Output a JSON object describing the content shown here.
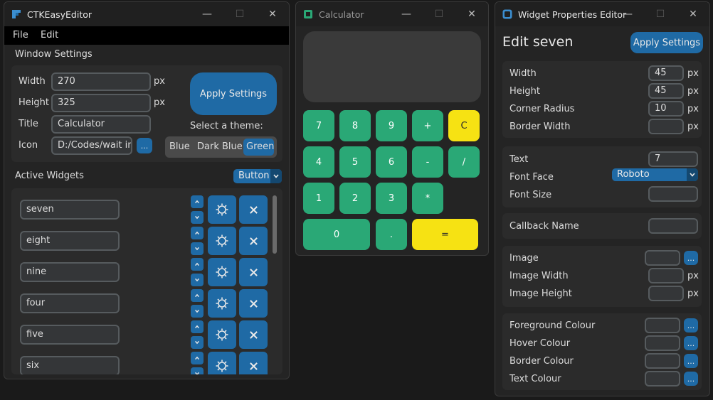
{
  "editor": {
    "title": "CTKEasyEditor",
    "menu": [
      "File",
      "Edit"
    ],
    "window_settings_label": "Window Settings",
    "width_label": "Width",
    "width_value": "270",
    "height_label": "Height",
    "height_value": "325",
    "title_label": "Title",
    "title_value": "Calculator",
    "icon_label": "Icon",
    "icon_value": "D:/Codes/wait im",
    "browse_label": "...",
    "px": "px",
    "apply_label": "Apply Settings",
    "theme_label": "Select a theme:",
    "themes": [
      "Blue",
      "Dark Blue",
      "Green"
    ],
    "active_theme": "Green",
    "active_widgets_label": "Active Widgets",
    "widget_type": "Button",
    "widgets": [
      "seven",
      "eight",
      "nine",
      "four",
      "five",
      "six"
    ],
    "colors": {
      "accent": "#1f6aa5",
      "panel": "#2b2b2b",
      "bg": "#242424"
    }
  },
  "calculator": {
    "title": "Calculator",
    "buttons": [
      {
        "label": "7",
        "color": "green"
      },
      {
        "label": "8",
        "color": "green"
      },
      {
        "label": "9",
        "color": "green"
      },
      {
        "label": "+",
        "color": "green"
      },
      {
        "label": "C",
        "color": "yellow"
      },
      {
        "label": "4",
        "color": "green"
      },
      {
        "label": "5",
        "color": "green"
      },
      {
        "label": "6",
        "color": "green"
      },
      {
        "label": "-",
        "color": "green"
      },
      {
        "label": "/",
        "color": "green"
      },
      {
        "label": "1",
        "color": "green"
      },
      {
        "label": "2",
        "color": "green"
      },
      {
        "label": "3",
        "color": "green"
      },
      {
        "label": "*",
        "color": "green"
      },
      {
        "label": "0",
        "color": "green"
      },
      {
        "label": ".",
        "color": "green"
      },
      {
        "label": "=",
        "color": "yellow"
      }
    ],
    "colors": {
      "green": "#2aa876",
      "yellow": "#f6e213"
    }
  },
  "props": {
    "title": "Widget Properties Editor",
    "heading": "Edit seven",
    "apply_label": "Apply Settings",
    "width_label": "Width",
    "width_value": "45",
    "height_label": "Height",
    "height_value": "45",
    "radius_label": "Corner Radius",
    "radius_value": "10",
    "border_label": "Border Width",
    "border_value": "",
    "text_label": "Text",
    "text_value": "7",
    "font_label": "Font Face",
    "font_value": "Roboto",
    "fontsize_label": "Font Size",
    "fontsize_value": "",
    "callback_label": "Callback Name",
    "callback_value": "",
    "image_label": "Image",
    "image_width_label": "Image Width",
    "image_height_label": "Image Height",
    "fg_label": "Foreground Colour",
    "hover_label": "Hover Colour",
    "bordercol_label": "Border Colour",
    "textcol_label": "Text Colour",
    "px": "px",
    "browse_label": "..."
  }
}
